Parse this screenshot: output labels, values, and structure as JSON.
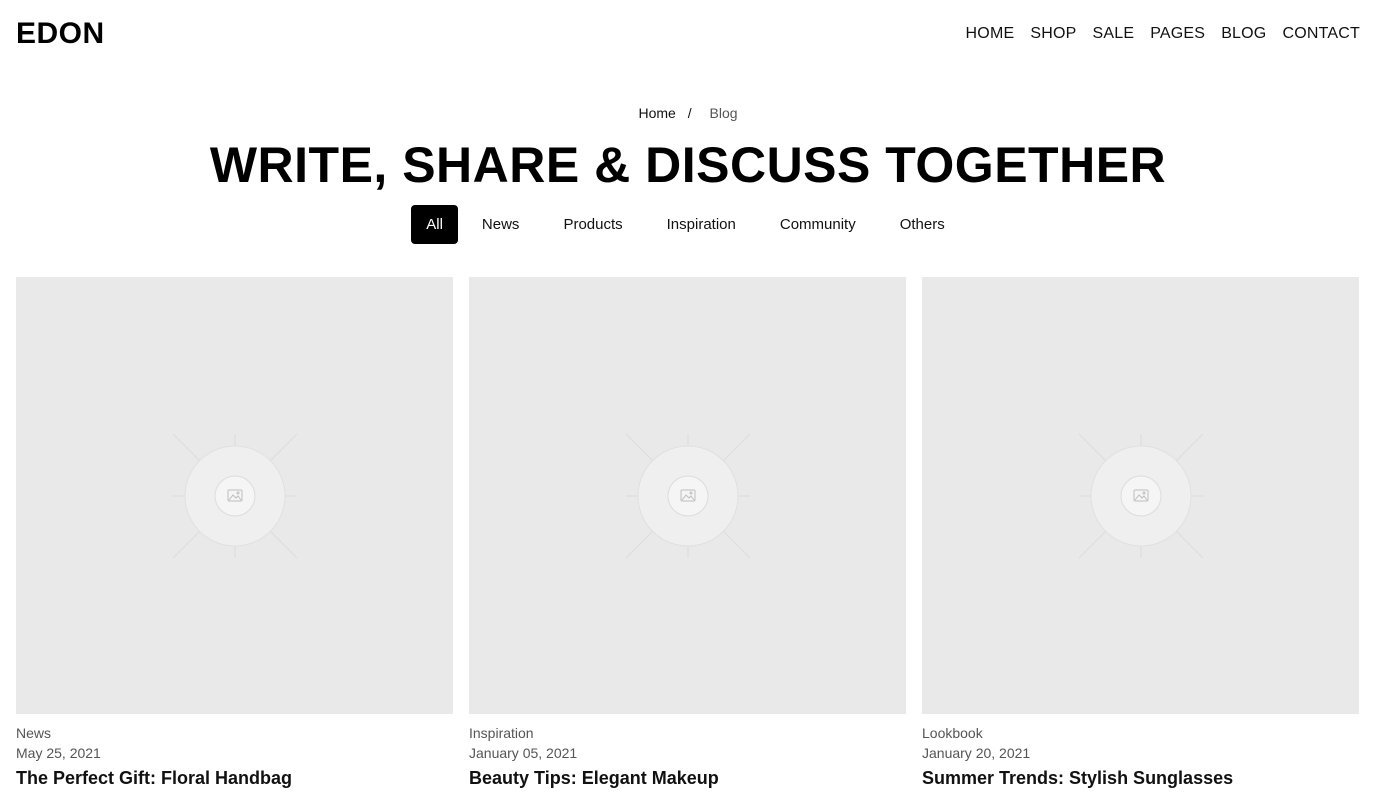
{
  "header": {
    "logo": "EDON",
    "nav": [
      "HOME",
      "SHOP",
      "SALE",
      "PAGES",
      "BLOG",
      "CONTACT"
    ]
  },
  "breadcrumb": {
    "home": "Home",
    "separator": "/",
    "current": "Blog"
  },
  "page_title": "WRITE, SHARE & DISCUSS TOGETHER",
  "filters": [
    "All",
    "News",
    "Products",
    "Inspiration",
    "Community",
    "Others"
  ],
  "active_filter": "All",
  "posts": [
    {
      "category": "News",
      "date": "May 25, 2021",
      "title": "The Perfect Gift: Floral Handbag",
      "image_icon": "image-placeholder-icon"
    },
    {
      "category": "Inspiration",
      "date": "January 05, 2021",
      "title": "Beauty Tips: Elegant Makeup",
      "image_icon": "image-placeholder-icon"
    },
    {
      "category": "Lookbook",
      "date": "January 20, 2021",
      "title": "Summer Trends: Stylish Sunglasses",
      "image_icon": "image-placeholder-icon"
    }
  ],
  "colors": {
    "accent": "#000000",
    "placeholder_bg": "#e9e9e9",
    "muted_text": "#555555"
  }
}
